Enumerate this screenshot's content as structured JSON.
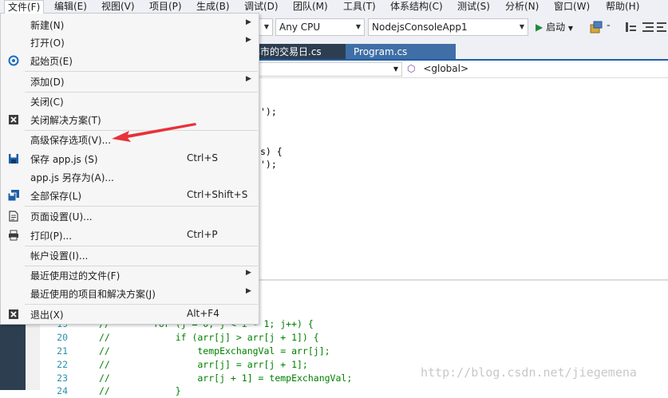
{
  "menubar": {
    "items": [
      "文件(F)",
      "编辑(E)",
      "视图(V)",
      "项目(P)",
      "生成(B)",
      "调试(D)",
      "团队(M)",
      "工具(T)",
      "体系结构(C)",
      "测试(S)",
      "分析(N)",
      "窗口(W)",
      "帮助(H)"
    ]
  },
  "toolbar": {
    "platform": "Any CPU",
    "project": "NodejsConsoleApp1",
    "start_label": "启动"
  },
  "tabs": {
    "tab1": "比市的交易日.cs",
    "tab2": "Program.cs"
  },
  "navbar": {
    "scope": "<global>"
  },
  "editor": {
    "top_fragments": [
      "');",
      "s) {",
      "');"
    ],
    "lines": [
      {
        "num": "19",
        "comment": "//",
        "code": "for (j = 0; j < i - 1; j++) {"
      },
      {
        "num": "20",
        "comment": "//",
        "code": "    if (arr[j] > arr[j + 1]) {"
      },
      {
        "num": "21",
        "comment": "//",
        "code": "        tempExchangVal = arr[j];"
      },
      {
        "num": "22",
        "comment": "//",
        "code": "        arr[j] = arr[j + 1];"
      },
      {
        "num": "23",
        "comment": "//",
        "code": "        arr[j + 1] = tempExchangVal;"
      },
      {
        "num": "24",
        "comment": "//",
        "code": "    }"
      }
    ]
  },
  "watermark": "http://blog.csdn.net/jiegemena",
  "file_menu": {
    "items": [
      {
        "label": "新建(N)",
        "shortcut": "",
        "submenu": true
      },
      {
        "label": "打开(O)",
        "shortcut": "",
        "submenu": true
      },
      {
        "label": "起始页(E)",
        "shortcut": "",
        "submenu": false
      },
      {
        "label": "添加(D)",
        "shortcut": "",
        "submenu": true
      },
      {
        "label": "关闭(C)",
        "shortcut": "",
        "submenu": false
      },
      {
        "label": "关闭解决方案(T)",
        "shortcut": "",
        "submenu": false
      },
      {
        "label": "高级保存选项(V)...",
        "shortcut": "",
        "submenu": false
      },
      {
        "label": "保存 app.js (S)",
        "shortcut": "Ctrl+S",
        "submenu": false
      },
      {
        "label": "app.js 另存为(A)...",
        "shortcut": "",
        "submenu": false
      },
      {
        "label": "全部保存(L)",
        "shortcut": "Ctrl+Shift+S",
        "submenu": false
      },
      {
        "label": "页面设置(U)...",
        "shortcut": "",
        "submenu": false
      },
      {
        "label": "打印(P)...",
        "shortcut": "Ctrl+P",
        "submenu": false
      },
      {
        "label": "帐户设置(I)...",
        "shortcut": "",
        "submenu": false
      },
      {
        "label": "最近使用过的文件(F)",
        "shortcut": "",
        "submenu": true
      },
      {
        "label": "最近使用的项目和解决方案(J)",
        "shortcut": "",
        "submenu": true
      },
      {
        "label": "退出(X)",
        "shortcut": "Alt+F4",
        "submenu": false
      }
    ]
  },
  "colors": {
    "accent": "#1f5ea8",
    "arrow": "#e8313a",
    "comment": "#008000",
    "line_number": "#2b91af"
  }
}
